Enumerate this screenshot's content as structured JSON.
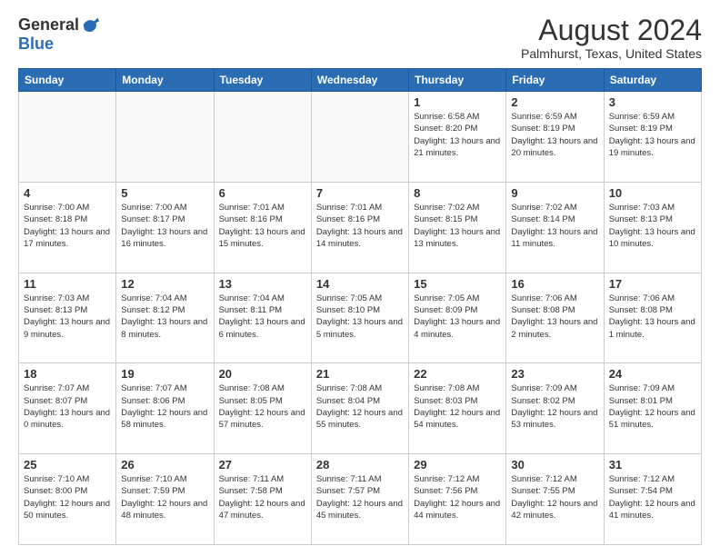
{
  "logo": {
    "general": "General",
    "blue": "Blue"
  },
  "title": "August 2024",
  "subtitle": "Palmhurst, Texas, United States",
  "days_of_week": [
    "Sunday",
    "Monday",
    "Tuesday",
    "Wednesday",
    "Thursday",
    "Friday",
    "Saturday"
  ],
  "weeks": [
    [
      {
        "day": "",
        "info": ""
      },
      {
        "day": "",
        "info": ""
      },
      {
        "day": "",
        "info": ""
      },
      {
        "day": "",
        "info": ""
      },
      {
        "day": "1",
        "info": "Sunrise: 6:58 AM\nSunset: 8:20 PM\nDaylight: 13 hours and 21 minutes."
      },
      {
        "day": "2",
        "info": "Sunrise: 6:59 AM\nSunset: 8:19 PM\nDaylight: 13 hours and 20 minutes."
      },
      {
        "day": "3",
        "info": "Sunrise: 6:59 AM\nSunset: 8:19 PM\nDaylight: 13 hours and 19 minutes."
      }
    ],
    [
      {
        "day": "4",
        "info": "Sunrise: 7:00 AM\nSunset: 8:18 PM\nDaylight: 13 hours and 17 minutes."
      },
      {
        "day": "5",
        "info": "Sunrise: 7:00 AM\nSunset: 8:17 PM\nDaylight: 13 hours and 16 minutes."
      },
      {
        "day": "6",
        "info": "Sunrise: 7:01 AM\nSunset: 8:16 PM\nDaylight: 13 hours and 15 minutes."
      },
      {
        "day": "7",
        "info": "Sunrise: 7:01 AM\nSunset: 8:16 PM\nDaylight: 13 hours and 14 minutes."
      },
      {
        "day": "8",
        "info": "Sunrise: 7:02 AM\nSunset: 8:15 PM\nDaylight: 13 hours and 13 minutes."
      },
      {
        "day": "9",
        "info": "Sunrise: 7:02 AM\nSunset: 8:14 PM\nDaylight: 13 hours and 11 minutes."
      },
      {
        "day": "10",
        "info": "Sunrise: 7:03 AM\nSunset: 8:13 PM\nDaylight: 13 hours and 10 minutes."
      }
    ],
    [
      {
        "day": "11",
        "info": "Sunrise: 7:03 AM\nSunset: 8:13 PM\nDaylight: 13 hours and 9 minutes."
      },
      {
        "day": "12",
        "info": "Sunrise: 7:04 AM\nSunset: 8:12 PM\nDaylight: 13 hours and 8 minutes."
      },
      {
        "day": "13",
        "info": "Sunrise: 7:04 AM\nSunset: 8:11 PM\nDaylight: 13 hours and 6 minutes."
      },
      {
        "day": "14",
        "info": "Sunrise: 7:05 AM\nSunset: 8:10 PM\nDaylight: 13 hours and 5 minutes."
      },
      {
        "day": "15",
        "info": "Sunrise: 7:05 AM\nSunset: 8:09 PM\nDaylight: 13 hours and 4 minutes."
      },
      {
        "day": "16",
        "info": "Sunrise: 7:06 AM\nSunset: 8:08 PM\nDaylight: 13 hours and 2 minutes."
      },
      {
        "day": "17",
        "info": "Sunrise: 7:06 AM\nSunset: 8:08 PM\nDaylight: 13 hours and 1 minute."
      }
    ],
    [
      {
        "day": "18",
        "info": "Sunrise: 7:07 AM\nSunset: 8:07 PM\nDaylight: 13 hours and 0 minutes."
      },
      {
        "day": "19",
        "info": "Sunrise: 7:07 AM\nSunset: 8:06 PM\nDaylight: 12 hours and 58 minutes."
      },
      {
        "day": "20",
        "info": "Sunrise: 7:08 AM\nSunset: 8:05 PM\nDaylight: 12 hours and 57 minutes."
      },
      {
        "day": "21",
        "info": "Sunrise: 7:08 AM\nSunset: 8:04 PM\nDaylight: 12 hours and 55 minutes."
      },
      {
        "day": "22",
        "info": "Sunrise: 7:08 AM\nSunset: 8:03 PM\nDaylight: 12 hours and 54 minutes."
      },
      {
        "day": "23",
        "info": "Sunrise: 7:09 AM\nSunset: 8:02 PM\nDaylight: 12 hours and 53 minutes."
      },
      {
        "day": "24",
        "info": "Sunrise: 7:09 AM\nSunset: 8:01 PM\nDaylight: 12 hours and 51 minutes."
      }
    ],
    [
      {
        "day": "25",
        "info": "Sunrise: 7:10 AM\nSunset: 8:00 PM\nDaylight: 12 hours and 50 minutes."
      },
      {
        "day": "26",
        "info": "Sunrise: 7:10 AM\nSunset: 7:59 PM\nDaylight: 12 hours and 48 minutes."
      },
      {
        "day": "27",
        "info": "Sunrise: 7:11 AM\nSunset: 7:58 PM\nDaylight: 12 hours and 47 minutes."
      },
      {
        "day": "28",
        "info": "Sunrise: 7:11 AM\nSunset: 7:57 PM\nDaylight: 12 hours and 45 minutes."
      },
      {
        "day": "29",
        "info": "Sunrise: 7:12 AM\nSunset: 7:56 PM\nDaylight: 12 hours and 44 minutes."
      },
      {
        "day": "30",
        "info": "Sunrise: 7:12 AM\nSunset: 7:55 PM\nDaylight: 12 hours and 42 minutes."
      },
      {
        "day": "31",
        "info": "Sunrise: 7:12 AM\nSunset: 7:54 PM\nDaylight: 12 hours and 41 minutes."
      }
    ]
  ]
}
